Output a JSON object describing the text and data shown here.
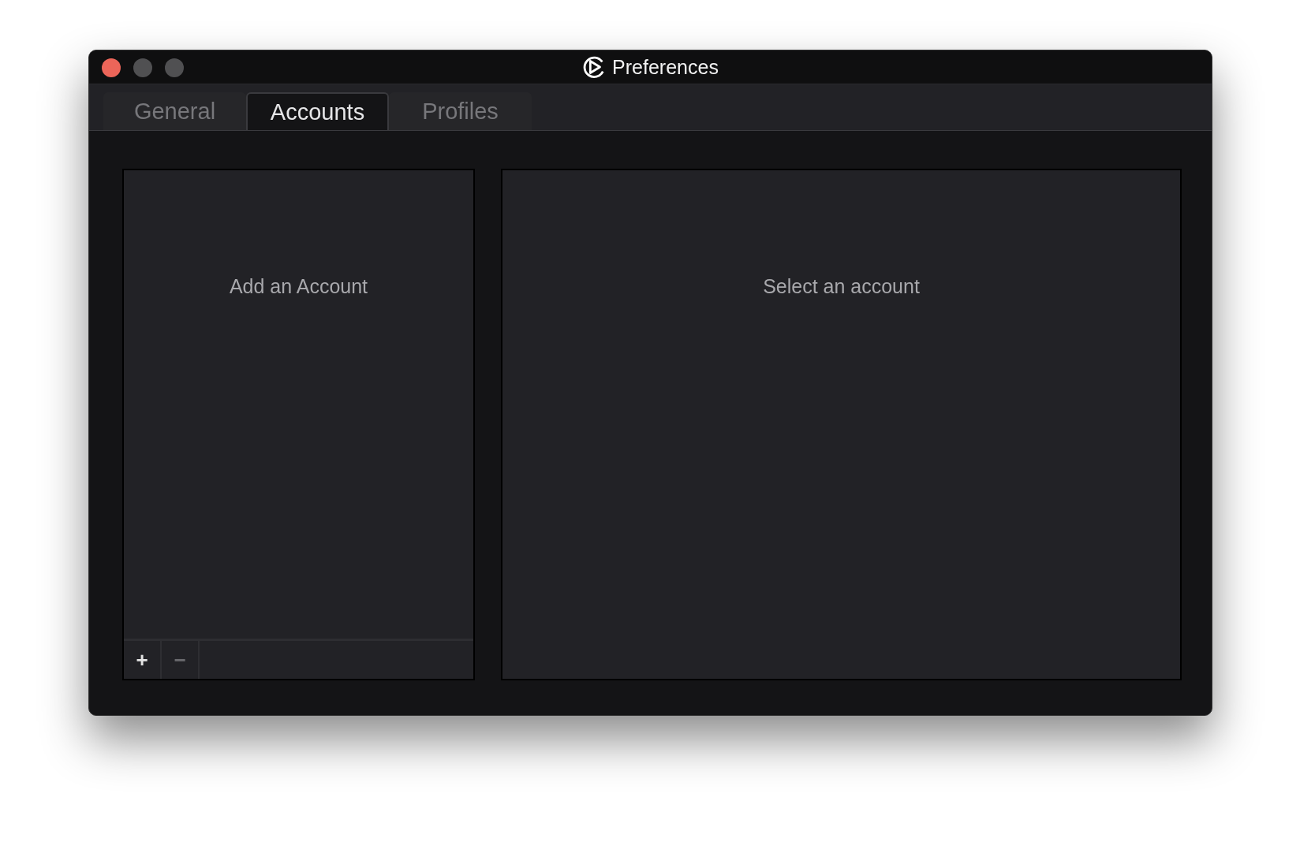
{
  "window": {
    "title": "Preferences"
  },
  "tabs": [
    {
      "label": "General",
      "selected": false
    },
    {
      "label": "Accounts",
      "selected": true
    },
    {
      "label": "Profiles",
      "selected": false
    }
  ],
  "account_list": {
    "empty_text": "Add an Account",
    "buttons": [
      {
        "label": "+",
        "disabled": false
      },
      {
        "label": "−",
        "disabled": true
      }
    ]
  },
  "detail_panel": {
    "empty_text": "Select an account"
  }
}
